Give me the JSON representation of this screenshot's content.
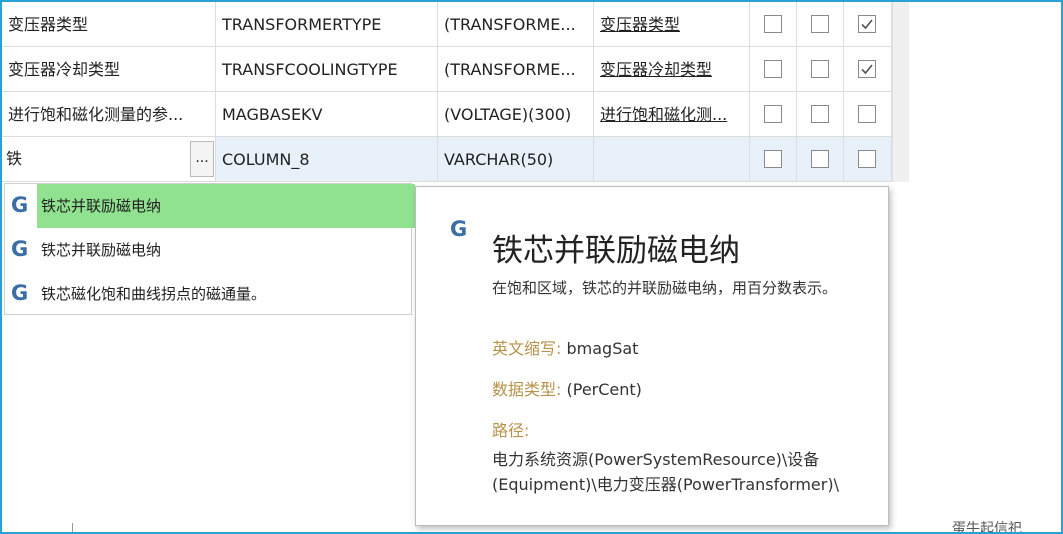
{
  "rows": [
    {
      "name": "变压器类型",
      "code": "TRANSFORMERTYPE",
      "type": "(TRANSFORME...",
      "link": "变压器类型",
      "checks": [
        false,
        false,
        true
      ]
    },
    {
      "name": "变压器冷却类型",
      "code": "TRANSFCOOLINGTYPE",
      "type": "(TRANSFORME...",
      "link": "变压器冷却类型",
      "checks": [
        false,
        false,
        true
      ]
    },
    {
      "name": "进行饱和磁化测量的参...",
      "code": "MAGBASEKV",
      "type": "(VOLTAGE)(300)",
      "link": "进行饱和磁化测...",
      "checks": [
        false,
        false,
        false
      ]
    }
  ],
  "edit_row": {
    "input": "铁",
    "button": "...",
    "code": "COLUMN_8",
    "type": "VARCHAR(50)",
    "checks": [
      false,
      false,
      false
    ]
  },
  "dropdown": {
    "icon": "G",
    "items": [
      "铁芯并联励磁电纳",
      "铁芯并联励磁电纳",
      "铁芯磁化饱和曲线拐点的磁通量。"
    ]
  },
  "popup": {
    "icon": "G",
    "title": "铁芯并联励磁电纳",
    "description": "在饱和区域，铁芯的并联励磁电纳，用百分数表示。",
    "abbr_label": "英文缩写:",
    "abbr_value": "bmagSat",
    "dtype_label": "数据类型:",
    "dtype_value": "(PerCent)",
    "path_label": "路径:",
    "path_value": "电力系统资源(PowerSystemResource)\\设备(Equipment)\\电力变压器(PowerTransformer)\\"
  },
  "bottom_fragment": "蛋牛起信祀"
}
